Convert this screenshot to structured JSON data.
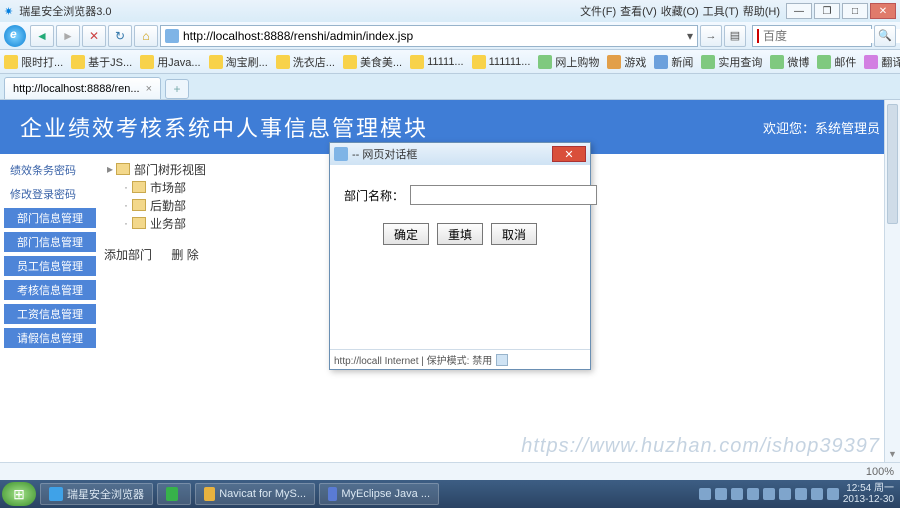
{
  "window": {
    "title": "瑞星安全浏览器3.0",
    "controls": {
      "min": "—",
      "max": "□",
      "restore": "❐",
      "close": "✕"
    }
  },
  "top_menu": [
    "文件(F)",
    "查看(V)",
    "收藏(O)",
    "工具(T)",
    "帮助(H)"
  ],
  "nav": {
    "back": "◄",
    "fwd": "►",
    "stop": "✕",
    "reload": "↻",
    "home": "⌂",
    "url": "http://localhost:8888/renshi/admin/index.jsp",
    "go": "→",
    "search_placeholder": "百度"
  },
  "linkbar_left": [
    "限时打...",
    "基于JS...",
    "用Java...",
    "淘宝刷...",
    "洗衣店...",
    "美食美...",
    "11111...",
    "111111..."
  ],
  "linkbar_right": [
    "网上购物",
    "游戏",
    "新闻",
    "实用查询",
    "微博",
    "邮件",
    "翻译"
  ],
  "tab": {
    "label": "http://localhost:8888/ren...",
    "close": "×",
    "new": "+"
  },
  "header": {
    "title": "企业绩效考核系统中人事信息管理模块",
    "welcome": "欢迎您：系统管理员"
  },
  "sidebar": {
    "items": [
      "绩效条务密码",
      "修改登录密码",
      "部门信息管理",
      "部门信息管理",
      "员工信息管理",
      "考核信息管理",
      "工资信息管理",
      "请假信息管理"
    ]
  },
  "tree": {
    "root": "部门树形视图",
    "children": [
      "市场部",
      "后勤部",
      "业务部"
    ],
    "actions": {
      "add": "添加部门",
      "del": "删 除"
    }
  },
  "modal": {
    "title": "-- 网页对话框",
    "field_label": "部门名称：",
    "field_value": "",
    "buttons": {
      "ok": "确定",
      "reset": "重填",
      "cancel": "取消"
    },
    "status": "http://locall  Internet | 保护模式: 禁用",
    "close": "✕"
  },
  "browser_status": {
    "zoom": "100%"
  },
  "taskbar": {
    "items": [
      "瑞星安全浏览器",
      "",
      "Navicat for MyS...",
      "MyEclipse Java ..."
    ],
    "clock": {
      "time": "12:54 周一",
      "date": "2013-12-30"
    }
  },
  "watermark": "https://www.huzhan.com/ishop39397"
}
